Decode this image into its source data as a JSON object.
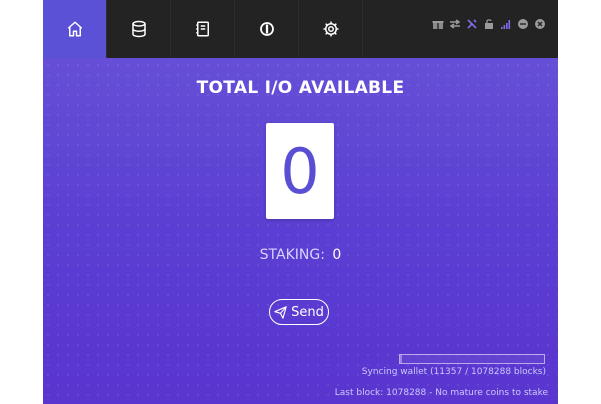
{
  "nav": {
    "tabs": [
      {
        "name": "home",
        "icon": "home-icon",
        "active": true
      },
      {
        "name": "coins",
        "icon": "database-icon",
        "active": false
      },
      {
        "name": "address-book",
        "icon": "address-book-icon",
        "active": false
      },
      {
        "name": "tools",
        "icon": "io-logo-icon",
        "active": false
      },
      {
        "name": "settings",
        "icon": "gear-icon",
        "active": false
      }
    ],
    "status_icons": [
      "gift-icon",
      "transfer-icon",
      "staking-icon",
      "lock-icon",
      "signal-icon",
      "minimize-icon",
      "close-icon"
    ]
  },
  "main": {
    "title": "TOTAL I/O AVAILABLE",
    "balance": "0",
    "staking_label": "STAKING:",
    "staking_value": "0",
    "send_label": "Send"
  },
  "footer": {
    "sync_text": "Syncing wallet (11357 / 1078288 blocks)",
    "sync_progress": 0.0105,
    "last_block_text": "Last block: 1078288 - No mature coins to stake"
  },
  "colors": {
    "accent": "#5b51d6",
    "topbar": "#232323",
    "background_top": "#6a55d8",
    "background_bottom": "#5a35cf"
  }
}
